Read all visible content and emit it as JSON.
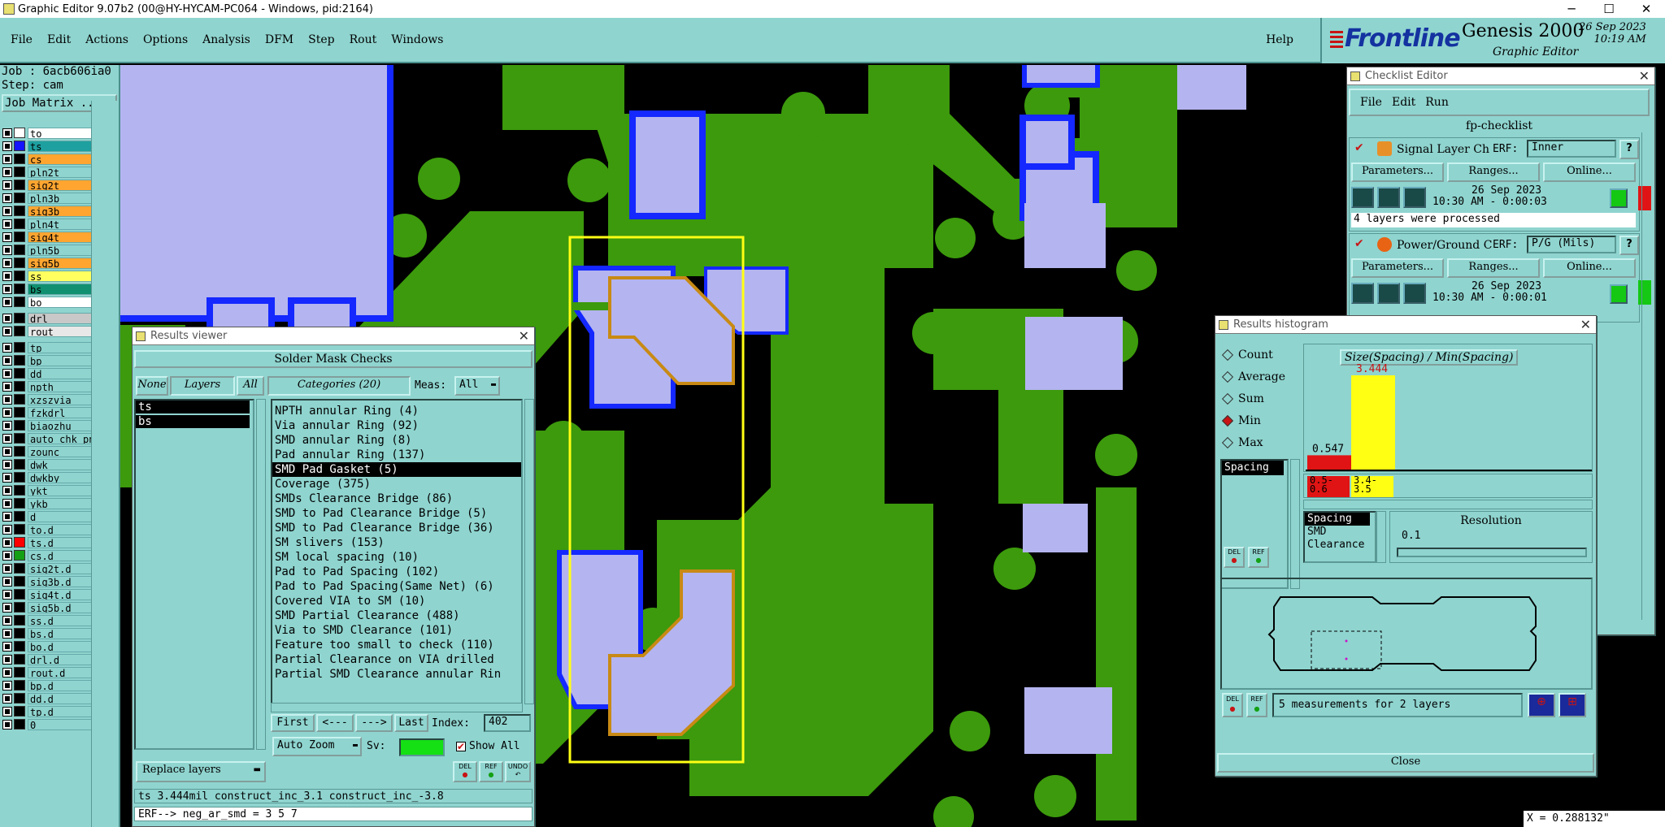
{
  "title_bar": {
    "text": "Graphic Editor 9.07b2 (00@HY-HYCAM-PC064 - Windows, pid:2164)",
    "minimize": "─",
    "maximize": "☐",
    "close": "✕"
  },
  "menu": {
    "items": [
      "File",
      "Edit",
      "Actions",
      "Options",
      "Analysis",
      "DFM",
      "Step",
      "Rout",
      "Windows"
    ],
    "help": "Help"
  },
  "brand": {
    "logo": "Frontline",
    "product": "Genesis 2000",
    "subtitle": "Graphic Editor",
    "date": "26 Sep 2023",
    "time": "10:19 AM"
  },
  "left_panel": {
    "job": "Job : 6acb606ia0",
    "step": "Step: cam",
    "job_matrix": "Job Matrix ...",
    "layers": [
      {
        "name": "to",
        "color": "#ffffff",
        "bg": "#ffffff"
      },
      {
        "name": "ts",
        "color": "#1414ff",
        "bg": "#1ea0a0"
      },
      {
        "name": "cs",
        "color": "#000000",
        "bg": "#ffa530"
      },
      {
        "name": "pln2t",
        "color": "#000000",
        "bg": "#8fd4cf"
      },
      {
        "name": "sig2t",
        "color": "#000000",
        "bg": "#ffa530"
      },
      {
        "name": "pln3b",
        "color": "#000000",
        "bg": "#8fd4cf"
      },
      {
        "name": "sig3b",
        "color": "#000000",
        "bg": "#ffa530"
      },
      {
        "name": "pln4t",
        "color": "#000000",
        "bg": "#8fd4cf"
      },
      {
        "name": "sig4t",
        "color": "#000000",
        "bg": "#ffa530"
      },
      {
        "name": "pln5b",
        "color": "#000000",
        "bg": "#8fd4cf"
      },
      {
        "name": "sig5b",
        "color": "#000000",
        "bg": "#ffa530"
      },
      {
        "name": "ss",
        "color": "#000000",
        "bg": "#ffff60"
      },
      {
        "name": "bs",
        "color": "#000000",
        "bg": "#109070"
      },
      {
        "name": "bo",
        "color": "#000000",
        "bg": "#ffffff"
      },
      {
        "name": "drl",
        "color": "#000000",
        "bg": "#c8c8c8"
      },
      {
        "name": "rout",
        "color": "#000000",
        "bg": "#e8e8e8"
      },
      {
        "name": "tp",
        "color": "#000000",
        "bg": "#8fd4cf"
      },
      {
        "name": "bp",
        "color": "#000000",
        "bg": "#8fd4cf"
      },
      {
        "name": "dd",
        "color": "#000000",
        "bg": "#8fd4cf"
      },
      {
        "name": "npth",
        "color": "#000000",
        "bg": "#8fd4cf"
      },
      {
        "name": "xzszvia",
        "color": "#000000",
        "bg": "#8fd4cf"
      },
      {
        "name": "fzkdrl",
        "color": "#000000",
        "bg": "#8fd4cf"
      },
      {
        "name": "biaozhu",
        "color": "#000000",
        "bg": "#8fd4cf"
      },
      {
        "name": "auto_chk_pn",
        "color": "#000000",
        "bg": "#8fd4cf"
      },
      {
        "name": "zounc",
        "color": "#000000",
        "bg": "#8fd4cf"
      },
      {
        "name": "dwk",
        "color": "#000000",
        "bg": "#8fd4cf"
      },
      {
        "name": "dwkby",
        "color": "#000000",
        "bg": "#8fd4cf"
      },
      {
        "name": "ykt",
        "color": "#000000",
        "bg": "#8fd4cf"
      },
      {
        "name": "ykb",
        "color": "#000000",
        "bg": "#8fd4cf"
      },
      {
        "name": "d",
        "color": "#000000",
        "bg": "#8fd4cf"
      },
      {
        "name": "to.d",
        "color": "#000000",
        "bg": "#8fd4cf"
      },
      {
        "name": "ts.d",
        "color": "#ff0000",
        "bg": "#8fd4cf"
      },
      {
        "name": "cs.d",
        "color": "#14a014",
        "bg": "#8fd4cf"
      },
      {
        "name": "sig2t.d",
        "color": "#000000",
        "bg": "#8fd4cf"
      },
      {
        "name": "sig3b.d",
        "color": "#000000",
        "bg": "#8fd4cf"
      },
      {
        "name": "sig4t.d",
        "color": "#000000",
        "bg": "#8fd4cf"
      },
      {
        "name": "sig5b.d",
        "color": "#000000",
        "bg": "#8fd4cf"
      },
      {
        "name": "ss.d",
        "color": "#000000",
        "bg": "#8fd4cf"
      },
      {
        "name": "bs.d",
        "color": "#000000",
        "bg": "#8fd4cf"
      },
      {
        "name": "bo.d",
        "color": "#000000",
        "bg": "#8fd4cf"
      },
      {
        "name": "drl.d",
        "color": "#000000",
        "bg": "#8fd4cf"
      },
      {
        "name": "rout.d",
        "color": "#000000",
        "bg": "#8fd4cf"
      },
      {
        "name": "bp.d",
        "color": "#000000",
        "bg": "#8fd4cf"
      },
      {
        "name": "dd.d",
        "color": "#000000",
        "bg": "#8fd4cf"
      },
      {
        "name": "tp.d",
        "color": "#000000",
        "bg": "#8fd4cf"
      },
      {
        "name": "0",
        "color": "#000000",
        "bg": "#8fd4cf"
      }
    ]
  },
  "results_viewer": {
    "title": "Results viewer",
    "header": "Solder Mask Checks",
    "none_btn": "None",
    "layers_btn": "Layers",
    "all_btn": "All",
    "categories_btn": "Categories (20)",
    "meas_label": "Meas:",
    "meas_value": "All",
    "layers": [
      "ts",
      "bs"
    ],
    "categories": [
      "NPTH annular Ring (4)",
      "Via annular Ring (92)",
      "SMD annular Ring (8)",
      "Pad annular Ring (137)",
      "SMD Pad Gasket (5)",
      "Coverage (375)",
      "SMDs Clearance Bridge (86)",
      "SMD to Pad Clearance Bridge (5)",
      "SMD to Pad Clearance Bridge (36)",
      "SM slivers (153)",
      "SM local spacing (10)",
      "Pad to Pad Spacing (102)",
      "Pad to Pad Spacing(Same Net) (6)",
      "Covered VIA to SM (10)",
      "SMD Partial Clearance (488)",
      "Via to SMD Clearance (101)",
      "Feature too small to check (110)",
      "Partial Clearance on VIA drilled",
      "Partial SMD Clearance annular Rin"
    ],
    "first": "First",
    "prev": "<---",
    "next": "--->",
    "last": "Last",
    "index_label": "Index:",
    "index_value": "402",
    "auto_zoom": "Auto Zoom",
    "sv_label": "Sv:",
    "show_all": "Show All",
    "replace_layers": "Replace layers",
    "del": "DEL",
    "ref": "REF",
    "undo": "UNDO",
    "status_line": "ts 3.444mil  construct_inc_3.1  construct_inc_-3.8",
    "erf_line": "ERF--> neg_ar_smd = 3 5 7"
  },
  "checklist": {
    "title": "Checklist Editor",
    "menu": [
      "File",
      "Edit",
      "Run"
    ],
    "name": "fp-checklist",
    "actions": [
      {
        "name": "Signal Layer Ch",
        "erf": "ERF:",
        "erf_value": "Inner",
        "params": "Parameters...",
        "ranges": "Ranges...",
        "online": "Online...",
        "date": "26 Sep 2023",
        "time": "10:30 AM - 0:00:03",
        "msg": "4 layers were processed",
        "status_color": "#e01414"
      },
      {
        "name": "Power/Ground C",
        "erf": "ERF:",
        "erf_value": "P/G (Mils)",
        "params": "Parameters...",
        "ranges": "Ranges...",
        "online": "Online...",
        "date": "26 Sep 2023",
        "time": "10:30 AM - 0:00:01",
        "msg": "",
        "status_color": "#14c814"
      }
    ],
    "help": "?"
  },
  "histogram": {
    "title": "Results histogram",
    "stats": [
      "Count",
      "Average",
      "Sum",
      "Min",
      "Max"
    ],
    "selected_stat": "Min",
    "list": [
      "Spacing"
    ],
    "chart_title": "Size(Spacing) / Min(Spacing)",
    "bars": [
      {
        "label": "0.5-0.6",
        "value": 0.547,
        "color": "#e01414"
      },
      {
        "label": "3.4-3.5",
        "value": 3.444,
        "color": "#ffff14"
      }
    ],
    "bar1_label": "0.547",
    "bar2_label": "3.444",
    "bin1": "0.5-\n0.6",
    "bin2": "3.4-\n3.5",
    "measure_list": [
      "Spacing",
      "SMD",
      "Clearance"
    ],
    "resolution_label": "Resolution",
    "resolution_value": "0.1",
    "del": "DEL",
    "ref": "REF",
    "measurements": "5 measurements for 2 layers",
    "close": "Close"
  },
  "coord_readout": "X = 0.288132\""
}
